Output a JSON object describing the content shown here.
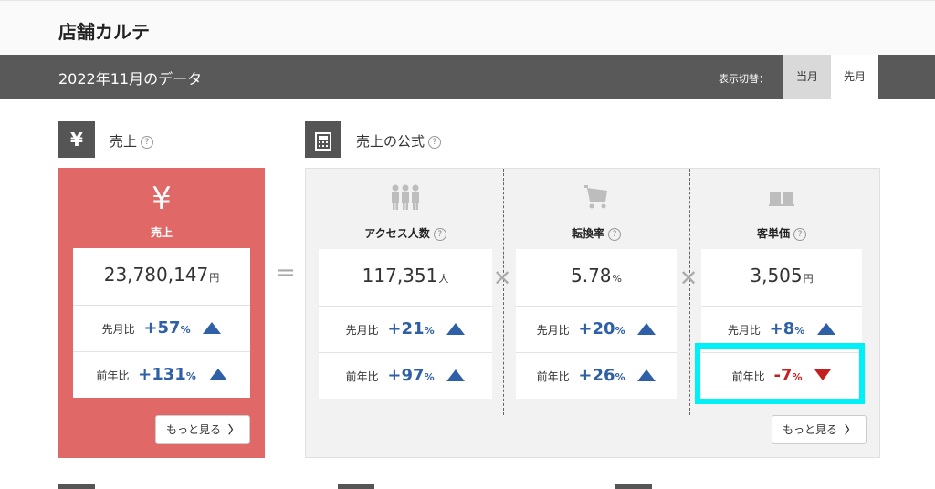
{
  "header": {
    "title": "店舗カルテ"
  },
  "data_bar": {
    "period_label": "2022年11月のデータ",
    "switch_label": "表示切替：",
    "tabs": {
      "current": "当月",
      "previous": "先月"
    }
  },
  "sales_section": {
    "icon": "yen-icon",
    "title": "売上",
    "card_label": "売上",
    "value": "23,780,147",
    "unit": "円",
    "mom_label": "先月比",
    "mom_sign": "+",
    "mom_value": "57",
    "yoy_label": "前年比",
    "yoy_sign": "+",
    "yoy_value": "131",
    "pct_unit": "%",
    "more_label": "もっと見る"
  },
  "formula_section": {
    "icon": "calculator-icon",
    "title": "売上の公式",
    "more_label": "もっと見る",
    "columns": [
      {
        "icon": "people-icon",
        "label": "アクセス人数",
        "value": "117,351",
        "unit": "人",
        "mom_label": "先月比",
        "mom_sign": "+",
        "mom_value": "21",
        "yoy_label": "前年比",
        "yoy_sign": "+",
        "yoy_value": "97"
      },
      {
        "icon": "cart-icon",
        "label": "転換率",
        "value": "5.78",
        "unit": "%",
        "mom_label": "先月比",
        "mom_sign": "+",
        "mom_value": "20",
        "yoy_label": "前年比",
        "yoy_sign": "+",
        "yoy_value": "26"
      },
      {
        "icon": "book-icon",
        "label": "客単価",
        "value": "3,505",
        "unit": "円",
        "mom_label": "先月比",
        "mom_sign": "+",
        "mom_value": "8",
        "yoy_label": "前年比",
        "yoy_sign": "-",
        "yoy_value": "7"
      }
    ]
  },
  "colors": {
    "sales_red": "#e06866",
    "positive_blue": "#2f5fa7",
    "negative_red": "#c61f1f",
    "highlight_cyan": "#00f0f8"
  }
}
